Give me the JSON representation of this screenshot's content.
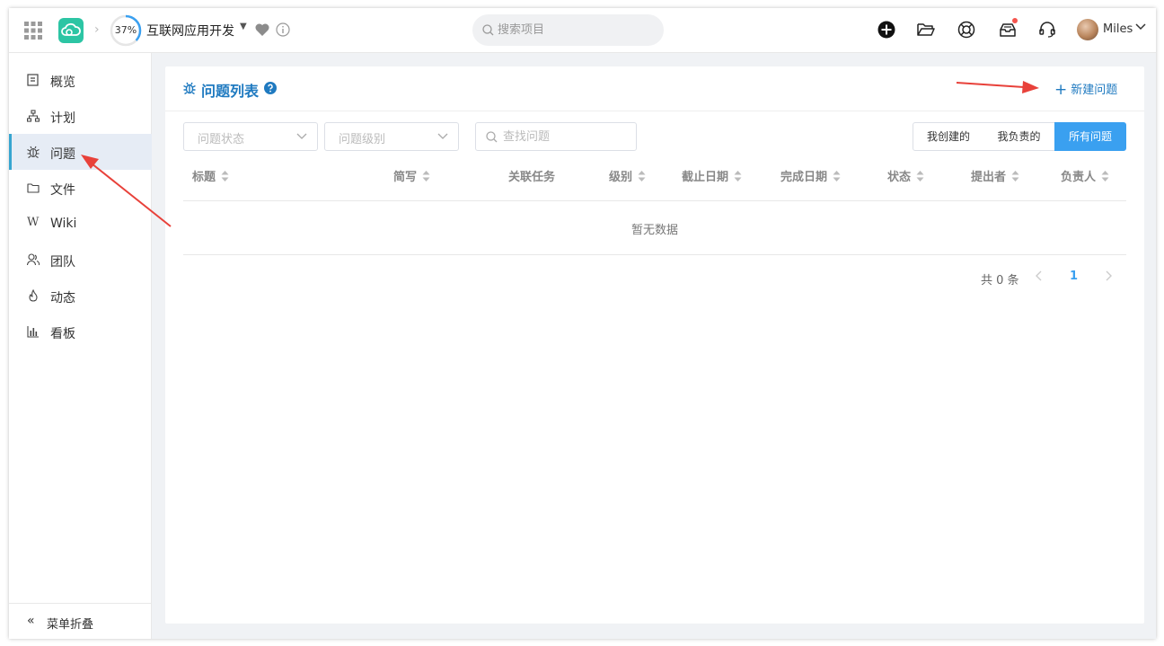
{
  "header": {
    "project_progress": "37%",
    "project_name": "互联网应用开发",
    "search_placeholder": "搜索项目",
    "username": "Miles"
  },
  "sidebar": {
    "items": [
      {
        "label": "概览",
        "icon": "overview-icon"
      },
      {
        "label": "计划",
        "icon": "plan-icon"
      },
      {
        "label": "问题",
        "icon": "bug-icon",
        "active": true
      },
      {
        "label": "文件",
        "icon": "folder-icon"
      },
      {
        "label": "Wiki",
        "icon": "wiki-icon"
      },
      {
        "label": "团队",
        "icon": "team-icon"
      },
      {
        "label": "动态",
        "icon": "fire-icon"
      },
      {
        "label": "看板",
        "icon": "chart-icon"
      }
    ],
    "collapse_label": "菜单折叠"
  },
  "panel": {
    "title": "问题列表",
    "new_issue_label": "新建问题",
    "filters": {
      "status_placeholder": "问题状态",
      "level_placeholder": "问题级别",
      "search_placeholder": "查找问题"
    },
    "scope_buttons": [
      "我创建的",
      "我负责的",
      "所有问题"
    ],
    "active_scope": "所有问题",
    "columns": [
      "标题",
      "简写",
      "关联任务",
      "级别",
      "截止日期",
      "完成日期",
      "状态",
      "提出者",
      "负责人"
    ],
    "empty_text": "暂无数据",
    "pagination": {
      "total_text": "共 0 条",
      "current_page": "1"
    }
  },
  "colors": {
    "accent": "#1f7ac0",
    "active_button": "#3aa0f0",
    "logo": "#2cc5a4",
    "annotation_arrow": "#e8413a"
  }
}
